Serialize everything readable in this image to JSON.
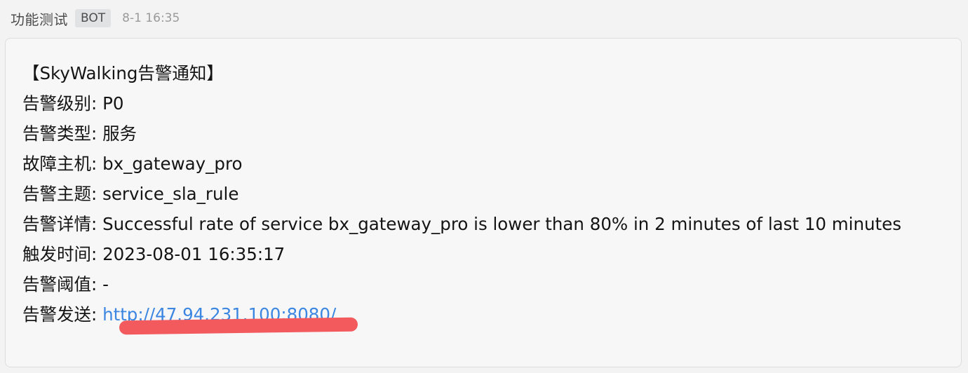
{
  "message": {
    "sender": "功能测试",
    "badge": "BOT",
    "time": "8-1 16:35"
  },
  "alert": {
    "title": "【SkyWalking告警通知】",
    "fields": [
      {
        "label": "告警级别:",
        "value": "P0"
      },
      {
        "label": "告警类型:",
        "value": "服务"
      },
      {
        "label": "故障主机:",
        "value": "bx_gateway_pro"
      },
      {
        "label": "告警主题:",
        "value": "service_sla_rule"
      },
      {
        "label": "告警详情:",
        "value": "Successful rate of service bx_gateway_pro is lower than 80% in 2 minutes of last 10 minutes"
      },
      {
        "label": "触发时间:",
        "value": "2023-08-01 16:35:17"
      },
      {
        "label": "告警阈值:",
        "value": "-"
      }
    ],
    "link_field": {
      "label": "告警发送:",
      "value": "http://47.94.231.100:8080/"
    }
  },
  "colors": {
    "link": "#3b86e1",
    "redaction": "#f25a5e",
    "bubble_background": "#f7f7f8"
  }
}
